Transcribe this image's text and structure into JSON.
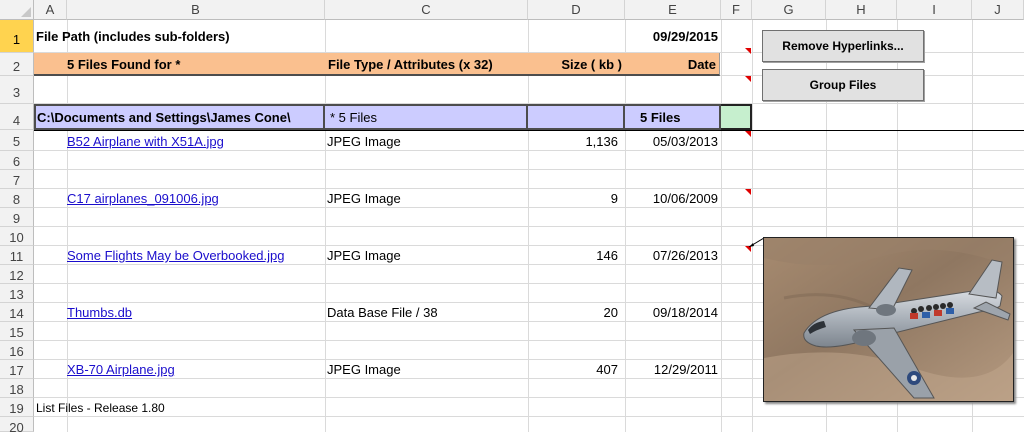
{
  "columns": [
    "A",
    "B",
    "C",
    "D",
    "E",
    "F",
    "G",
    "H",
    "I",
    "J"
  ],
  "rows": [
    "1",
    "2",
    "3",
    "4",
    "5",
    "6",
    "7",
    "8",
    "9",
    "10",
    "11",
    "12",
    "13",
    "14",
    "15",
    "16",
    "17",
    "18",
    "19",
    "20"
  ],
  "header": {
    "file_path_label": "File Path (includes sub-folders)",
    "date": "09/29/2015",
    "found_label": "5 Files Found for  *",
    "type_header": "File Type / Attributes (x 32)",
    "size_header": "Size ( kb )",
    "date_header": "Date",
    "path_value": "C:\\Documents and Settings\\James Cone\\",
    "files_pattern": "  *  5 Files",
    "files_count": "5 Files"
  },
  "files": [
    {
      "name": "B52 Airplane with X51A.jpg",
      "type": "JPEG Image",
      "size": "1,136",
      "date": "05/03/2013"
    },
    {
      "name": "C17 airplanes_091006.jpg",
      "type": "JPEG Image",
      "size": "9",
      "date": "10/06/2009"
    },
    {
      "name": "Some Flights May be Overbooked.jpg",
      "type": "JPEG Image",
      "size": "146",
      "date": "07/26/2013"
    },
    {
      "name": "Thumbs.db",
      "type": "Data Base File / 38",
      "size": "20",
      "date": "09/18/2014"
    },
    {
      "name": "XB-70 Airplane.jpg",
      "type": "JPEG Image",
      "size": "407",
      "date": "12/29/2011"
    }
  ],
  "footer": "List Files - Release 1.80",
  "buttons": {
    "remove_hyperlinks": "Remove Hyperlinks...",
    "group_files": "Group Files"
  },
  "colors": {
    "header_orange": "#fac08f",
    "header_blue": "#ccccff",
    "selected_green": "#c6efce",
    "link": "#1a0dcc",
    "active_row": "#ffd34f"
  },
  "picture": {
    "subject": "airplane-photo"
  }
}
